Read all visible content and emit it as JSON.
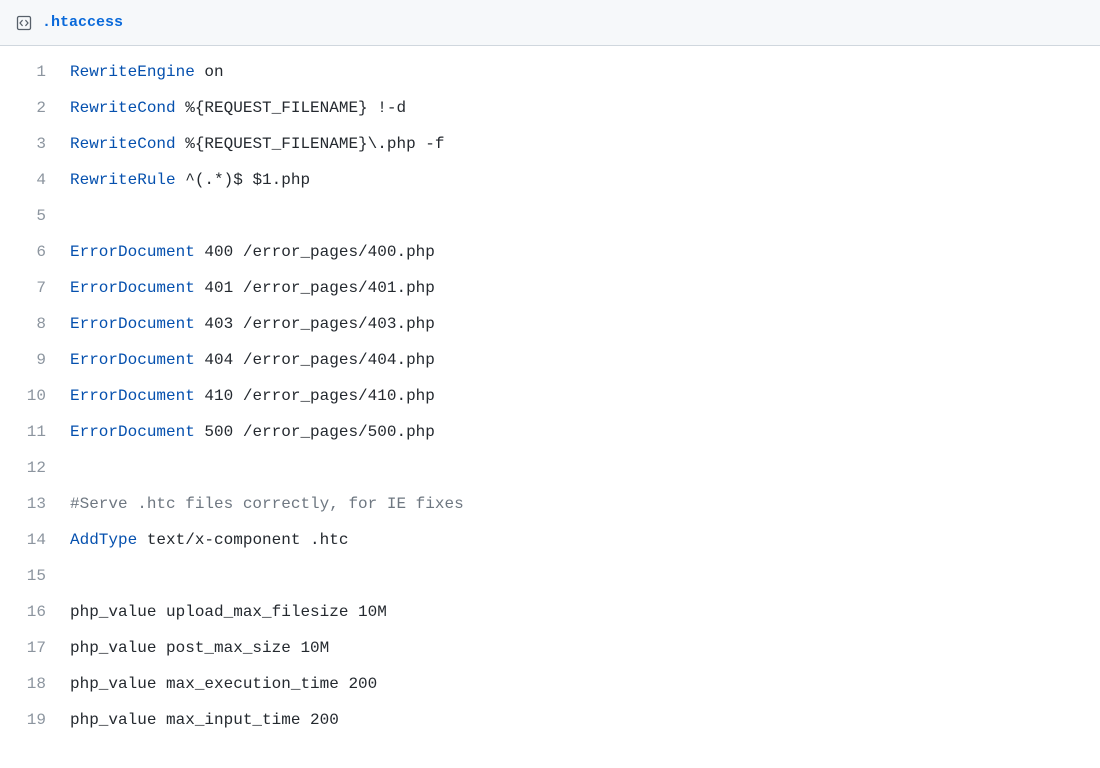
{
  "file": {
    "name": ".htaccess"
  },
  "lines": [
    {
      "n": 1,
      "tokens": [
        {
          "cls": "directive",
          "t": "RewriteEngine"
        },
        {
          "cls": "plain",
          "t": " on"
        }
      ]
    },
    {
      "n": 2,
      "tokens": [
        {
          "cls": "directive",
          "t": "RewriteCond"
        },
        {
          "cls": "plain",
          "t": " %{REQUEST_FILENAME} !-d"
        }
      ]
    },
    {
      "n": 3,
      "tokens": [
        {
          "cls": "directive",
          "t": "RewriteCond"
        },
        {
          "cls": "plain",
          "t": " %{REQUEST_FILENAME}\\.php -f"
        }
      ]
    },
    {
      "n": 4,
      "tokens": [
        {
          "cls": "directive",
          "t": "RewriteRule"
        },
        {
          "cls": "plain",
          "t": " ^(.*)$ $1.php"
        }
      ]
    },
    {
      "n": 5,
      "tokens": [
        {
          "cls": "plain",
          "t": ""
        }
      ]
    },
    {
      "n": 6,
      "tokens": [
        {
          "cls": "directive",
          "t": "ErrorDocument"
        },
        {
          "cls": "plain",
          "t": " 400 /error_pages/400.php"
        }
      ]
    },
    {
      "n": 7,
      "tokens": [
        {
          "cls": "directive",
          "t": "ErrorDocument"
        },
        {
          "cls": "plain",
          "t": " 401 /error_pages/401.php"
        }
      ]
    },
    {
      "n": 8,
      "tokens": [
        {
          "cls": "directive",
          "t": "ErrorDocument"
        },
        {
          "cls": "plain",
          "t": " 403 /error_pages/403.php"
        }
      ]
    },
    {
      "n": 9,
      "tokens": [
        {
          "cls": "directive",
          "t": "ErrorDocument"
        },
        {
          "cls": "plain",
          "t": " 404 /error_pages/404.php"
        }
      ]
    },
    {
      "n": 10,
      "tokens": [
        {
          "cls": "directive",
          "t": "ErrorDocument"
        },
        {
          "cls": "plain",
          "t": " 410 /error_pages/410.php"
        }
      ]
    },
    {
      "n": 11,
      "tokens": [
        {
          "cls": "directive",
          "t": "ErrorDocument"
        },
        {
          "cls": "plain",
          "t": " 500 /error_pages/500.php"
        }
      ]
    },
    {
      "n": 12,
      "tokens": [
        {
          "cls": "plain",
          "t": ""
        }
      ]
    },
    {
      "n": 13,
      "tokens": [
        {
          "cls": "comment",
          "t": "#Serve .htc files correctly, for IE fixes"
        }
      ]
    },
    {
      "n": 14,
      "tokens": [
        {
          "cls": "directive",
          "t": "AddType"
        },
        {
          "cls": "plain",
          "t": " text/x-component .htc"
        }
      ]
    },
    {
      "n": 15,
      "tokens": [
        {
          "cls": "plain",
          "t": ""
        }
      ]
    },
    {
      "n": 16,
      "tokens": [
        {
          "cls": "plain",
          "t": "php_value upload_max_filesize 10M"
        }
      ]
    },
    {
      "n": 17,
      "tokens": [
        {
          "cls": "plain",
          "t": "php_value post_max_size 10M"
        }
      ]
    },
    {
      "n": 18,
      "tokens": [
        {
          "cls": "plain",
          "t": "php_value max_execution_time 200"
        }
      ]
    },
    {
      "n": 19,
      "tokens": [
        {
          "cls": "plain",
          "t": "php_value max_input_time 200"
        }
      ]
    }
  ]
}
